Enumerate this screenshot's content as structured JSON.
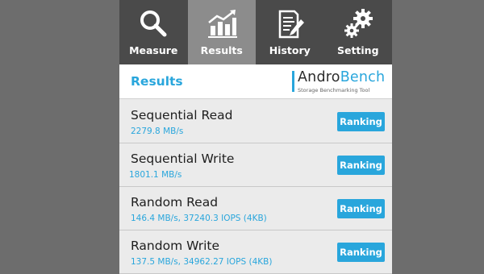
{
  "tabs": [
    {
      "label": "Measure",
      "icon": "magnifier-icon"
    },
    {
      "label": "Results",
      "icon": "bar-chart-icon",
      "active": true
    },
    {
      "label": "History",
      "icon": "document-pencil-icon"
    },
    {
      "label": "Setting",
      "icon": "gears-icon"
    }
  ],
  "header": {
    "title": "Results",
    "brand_prefix": "Andro",
    "brand_suffix": "Bench",
    "brand_tagline": "Storage Benchmarking Tool"
  },
  "results": [
    {
      "name": "Sequential Read",
      "value": "2279.8 MB/s",
      "button": "Ranking"
    },
    {
      "name": "Sequential Write",
      "value": "1801.1 MB/s",
      "button": "Ranking"
    },
    {
      "name": "Random Read",
      "value": "146.4 MB/s, 37240.3 IOPS (4KB)",
      "button": "Ranking"
    },
    {
      "name": "Random Write",
      "value": "137.5 MB/s, 34962.27 IOPS (4KB)",
      "button": "Ranking"
    }
  ],
  "colors": {
    "accent": "#29a6dc",
    "tabbar": "#4a4a4a",
    "tab_active": "#8c8c8c",
    "background": "#6d6d6d"
  }
}
